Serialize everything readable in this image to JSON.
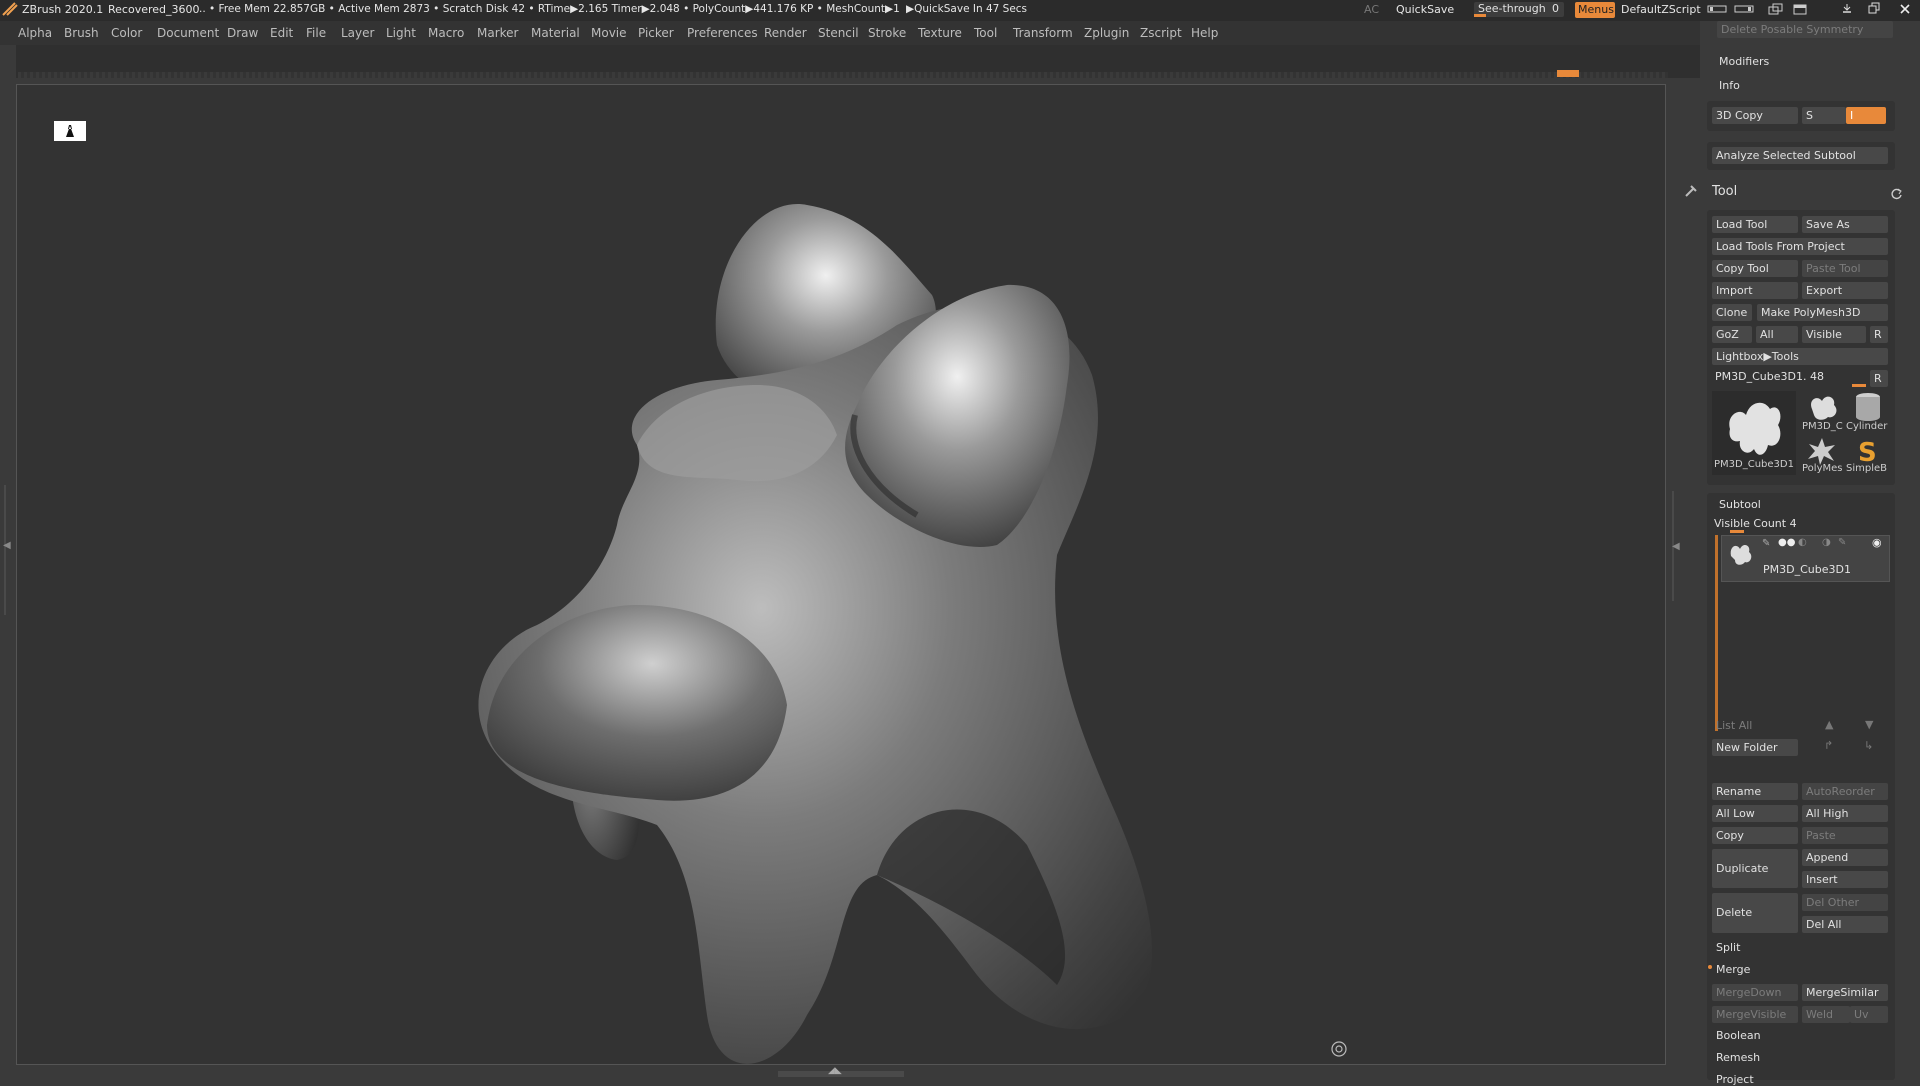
{
  "titlebar": {
    "app": "ZBrush 2020.1",
    "file": "Recovered_3600",
    "stats": ".. • Free Mem 22.857GB • Active Mem 2873 • Scratch Disk 42 • RTime▶2.165 Timer▶2.048 • PolyCount▶441.176 KP • MeshCount▶1",
    "quicksave_timer": "▶QuickSave In 47 Secs",
    "ac": "AC",
    "quicksave": "QuickSave",
    "see_through_label": "See-through",
    "see_through_value": "0",
    "menus": "Menus",
    "script": "DefaultZScript"
  },
  "menu": [
    "Alpha",
    "Brush",
    "Color",
    "Document",
    "Draw",
    "Edit",
    "File",
    "Layer",
    "Light",
    "Macro",
    "Marker",
    "Material",
    "Movie",
    "Picker",
    "Preferences",
    "Render",
    "Stencil",
    "Stroke",
    "Texture",
    "Tool",
    "Transform",
    "Zplugin",
    "Zscript",
    "Help"
  ],
  "rpanel": {
    "delete_posable_symmetry": "Delete Posable Symmetry",
    "modifiers": "Modifiers",
    "info": "Info",
    "copy3d": "3D Copy",
    "copy3d_s": "S",
    "copy3d_value": "I",
    "analyze": "Analyze Selected Subtool",
    "tool_title": "Tool",
    "load_tool": "Load Tool",
    "save_as": "Save As",
    "load_from_project": "Load Tools From Project",
    "copy_tool": "Copy Tool",
    "paste_tool": "Paste Tool",
    "import": "Import",
    "export": "Export",
    "clone": "Clone",
    "make_polymesh": "Make PolyMesh3D",
    "goz": "GoZ",
    "all": "All",
    "visible": "Visible",
    "r": "R",
    "lightbox_tools": "Lightbox▶Tools",
    "current_tool": "PM3D_Cube3D1. 48",
    "current_tool_r": "R",
    "thumbs": {
      "main": "PM3D_Cube3D1",
      "t1": "PM3D_C",
      "t2": "Cylinder",
      "t3": "PolyMes",
      "t4": "SimpleB"
    },
    "subtool": "Subtool",
    "visible_count": "Visible Count 4",
    "subtool_item": "PM3D_Cube3D1",
    "list_all": "List All",
    "new_folder": "New Folder",
    "rename": "Rename",
    "autoreorder": "AutoReorder",
    "all_low": "All Low",
    "all_high": "All High",
    "copy": "Copy",
    "paste": "Paste",
    "duplicate": "Duplicate",
    "append": "Append",
    "insert": "Insert",
    "delete": "Delete",
    "del_other": "Del Other",
    "del_all": "Del All",
    "split": "Split",
    "merge": "Merge",
    "mergedown": "MergeDown",
    "mergesimilar": "MergeSimilar",
    "mergevisible": "MergeVisible",
    "weld": "Weld",
    "uv": "Uv",
    "boolean": "Boolean",
    "remesh": "Remesh",
    "project": "Project"
  },
  "colors": {
    "accent": "#e8893a",
    "panel": "#3a3a3a",
    "canvas": "#333333"
  }
}
